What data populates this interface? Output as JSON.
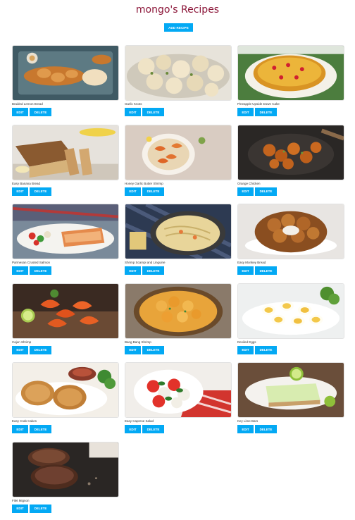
{
  "page": {
    "title": "mongo's Recipes",
    "add_label": "ADD RECIPE",
    "accent": "#03a9f4",
    "title_color": "#8b1538"
  },
  "recipes": [
    {
      "name": "Braided Lemon Bread",
      "edit": "EDIT",
      "delete": "DELETE",
      "image": "braided-bread"
    },
    {
      "name": "Garlic Knots",
      "edit": "EDIT",
      "delete": "DELETE",
      "image": "garlic-knots"
    },
    {
      "name": "Pineapple Upside Down Cake",
      "edit": "EDIT",
      "delete": "DELETE",
      "image": "pineapple-cake"
    },
    {
      "name": "Easy Banana Bread",
      "edit": "EDIT",
      "delete": "DELETE",
      "image": "banana-bread"
    },
    {
      "name": "Honey Garlic Butter Shrimp",
      "edit": "EDIT",
      "delete": "DELETE",
      "image": "honey-shrimp"
    },
    {
      "name": "Orange Chicken",
      "edit": "EDIT",
      "delete": "DELETE",
      "image": "orange-chicken"
    },
    {
      "name": "Parmesan Crusted Salmon",
      "edit": "EDIT",
      "delete": "DELETE",
      "image": "salmon"
    },
    {
      "name": "Shrimp Scampi and Linguine",
      "edit": "EDIT",
      "delete": "DELETE",
      "image": "scampi"
    },
    {
      "name": "Easy Monkey Bread",
      "edit": "EDIT",
      "delete": "DELETE",
      "image": "monkey-bread"
    },
    {
      "name": "Cajun Shrimp",
      "edit": "EDIT",
      "delete": "DELETE",
      "image": "cajun-shrimp"
    },
    {
      "name": "Bang Bang Shrimp",
      "edit": "EDIT",
      "delete": "DELETE",
      "image": "bang-shrimp"
    },
    {
      "name": "Deviled Eggs",
      "edit": "EDIT",
      "delete": "DELETE",
      "image": "deviled-eggs"
    },
    {
      "name": "Easy Crab Cakes",
      "edit": "EDIT",
      "delete": "DELETE",
      "image": "crab-cakes"
    },
    {
      "name": "Easy Caprese Salad",
      "edit": "EDIT",
      "delete": "DELETE",
      "image": "caprese"
    },
    {
      "name": "Key Lime Bars",
      "edit": "EDIT",
      "delete": "DELETE",
      "image": "key-lime"
    },
    {
      "name": "Filet Mignon",
      "edit": "EDIT",
      "delete": "DELETE",
      "image": "filet"
    }
  ]
}
